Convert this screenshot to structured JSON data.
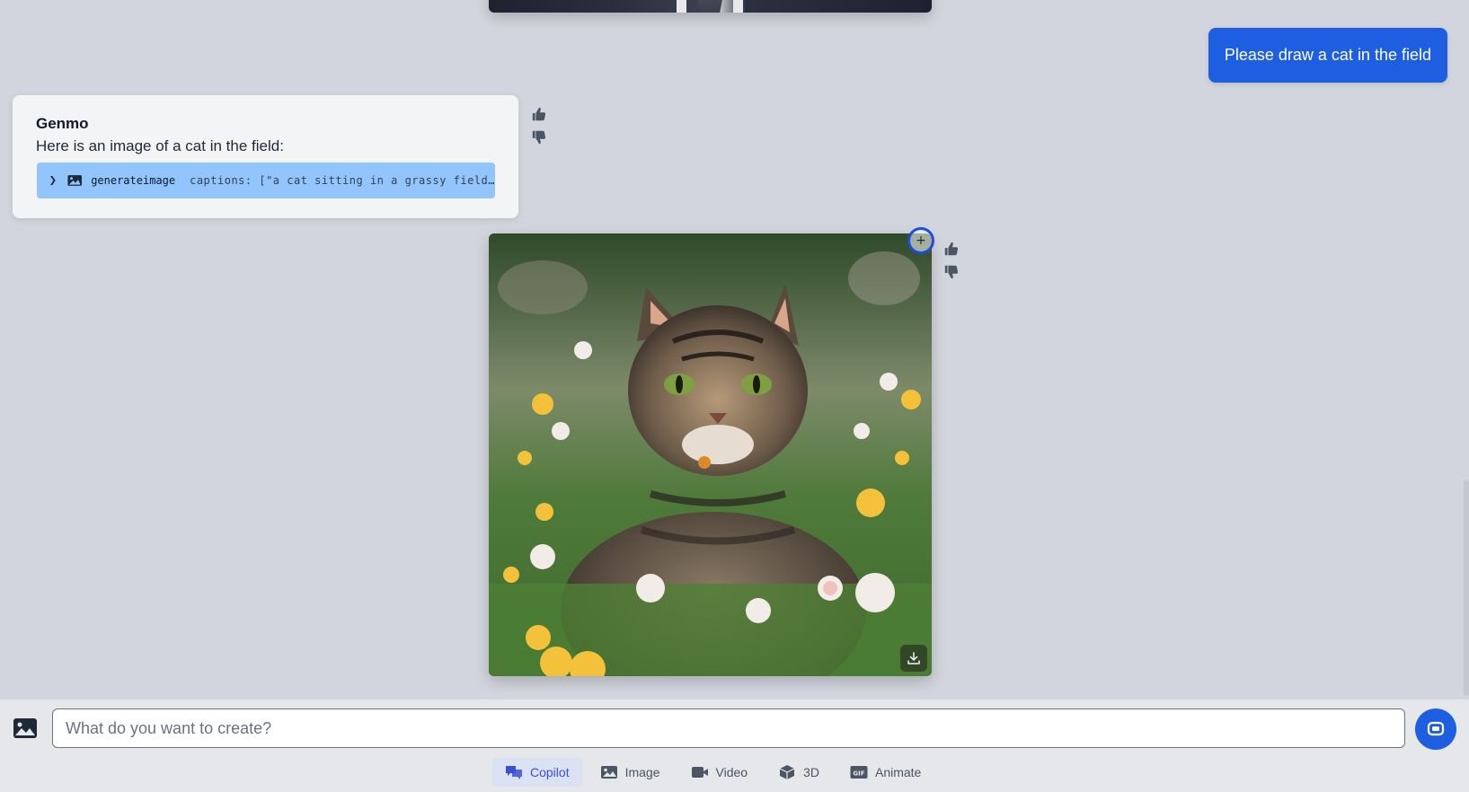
{
  "user_message": "Please draw a cat in the field",
  "assistant": {
    "name": "Genmo",
    "text": "Here is an image of a cat in the field:",
    "tool_call": {
      "name": "generateimage",
      "args": "captions: [\"a cat sitting in a grassy field…"
    }
  },
  "icons": {
    "thumbs_up": "thumbs-up-icon",
    "thumbs_down": "thumbs-down-icon",
    "add": "plus-icon",
    "download": "download-icon",
    "upload_image": "image-icon",
    "send": "chat-icon",
    "expand": "chevron-right-icon"
  },
  "composer": {
    "placeholder": "What do you want to create?"
  },
  "modes": [
    {
      "label": "Copilot",
      "icon": "chat-bubbles-icon",
      "active": true
    },
    {
      "label": "Image",
      "icon": "image-icon",
      "active": false
    },
    {
      "label": "Video",
      "icon": "video-camera-icon",
      "active": false
    },
    {
      "label": "3D",
      "icon": "cube-icon",
      "active": false
    },
    {
      "label": "Animate",
      "icon": "gif-icon",
      "active": false
    }
  ],
  "colors": {
    "accent": "#1d5fe0",
    "tool_chip": "#93c5fd",
    "background": "#d2d5dd",
    "active_tab_text": "#3b4fd8"
  }
}
